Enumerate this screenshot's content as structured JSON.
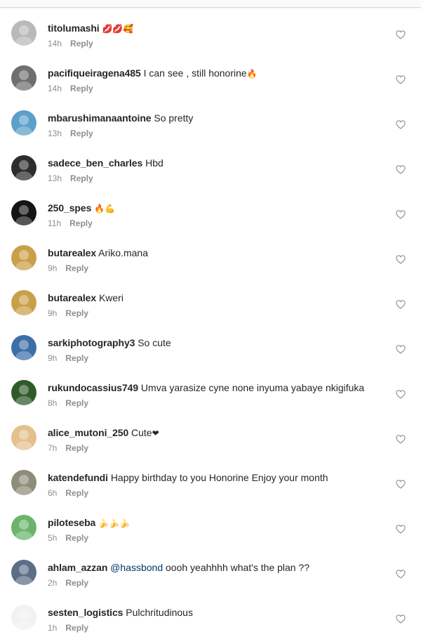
{
  "comments": [
    {
      "username": "titolumashi",
      "text": "",
      "emoji": "💋💋🥰",
      "time": "14h",
      "reply": "Reply",
      "avatar_color": "#b9b9b9"
    },
    {
      "username": "pacifiqueiragena485",
      "text": "I can see , still honorine",
      "emoji": "🔥",
      "time": "14h",
      "reply": "Reply",
      "avatar_color": "#6f6f6f"
    },
    {
      "username": "mbarushimanaantoine",
      "text": "So pretty",
      "emoji": "",
      "time": "13h",
      "reply": "Reply",
      "avatar_color": "#5aa0c8"
    },
    {
      "username": "sadece_ben_charles",
      "text": "Hbd",
      "emoji": "",
      "time": "13h",
      "reply": "Reply",
      "avatar_color": "#2d2d2d"
    },
    {
      "username": "250_spes",
      "text": "",
      "emoji": "🔥💪",
      "time": "11h",
      "reply": "Reply",
      "avatar_color": "#141414"
    },
    {
      "username": "butarealex",
      "text": "Ariko.mana",
      "emoji": "",
      "time": "9h",
      "reply": "Reply",
      "avatar_color": "#c9a04a"
    },
    {
      "username": "butarealex",
      "text": "Kweri",
      "emoji": "",
      "time": "9h",
      "reply": "Reply",
      "avatar_color": "#c9a04a"
    },
    {
      "username": "sarkiphotography3",
      "text": "So cute",
      "emoji": "",
      "time": "9h",
      "reply": "Reply",
      "avatar_color": "#3c6fa8"
    },
    {
      "username": "rukundocassius749",
      "text": "Umva yarasize cyne none inyuma yabaye nkigifuka",
      "emoji": "",
      "time": "8h",
      "reply": "Reply",
      "avatar_color": "#2f5a2a"
    },
    {
      "username": "alice_mutoni_250",
      "text": "Cute",
      "emoji": "❤",
      "time": "7h",
      "reply": "Reply",
      "avatar_color": "#e4c08e"
    },
    {
      "username": "katendefundi",
      "text": "Happy birthday to you Honorine  Enjoy your month",
      "emoji": "",
      "time": "6h",
      "reply": "Reply",
      "avatar_color": "#8d8d7a"
    },
    {
      "username": "piloteseba",
      "text": "",
      "emoji": "🍌🍌🍌",
      "time": "5h",
      "reply": "Reply",
      "avatar_color": "#6ab56a"
    },
    {
      "username": "ahlam_azzan",
      "text": "oooh yeahhhh what's the plan ??",
      "mention": "@hassbond",
      "emoji": "",
      "time": "2h",
      "reply": "Reply",
      "avatar_color": "#5c6e86"
    },
    {
      "username": "sesten_logistics",
      "text": "Pulchritudinous",
      "emoji": "",
      "time": "1h",
      "reply": "Reply",
      "avatar_color": "#f2f2f2"
    }
  ],
  "colors": {
    "text": "#262626",
    "meta": "#8e8e8e",
    "mention": "#003569",
    "heart_stroke": "#8e8e8e"
  },
  "icons": {
    "like": "heart-outline-icon"
  }
}
